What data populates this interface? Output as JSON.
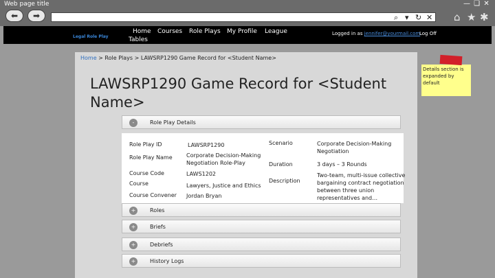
{
  "browser": {
    "window_title": "Web page title",
    "window_controls": "— ❑ ✕",
    "back_icon": "⬅",
    "forward_icon": "➡",
    "search_icon": "⌕",
    "dropdown_icon": "▾",
    "refresh_icon": "↻",
    "close_icon": "✕",
    "home_icon": "⌂",
    "star_icon": "★",
    "settings_icon": "✱",
    "address": ""
  },
  "site": {
    "logo": "Legal Role Play",
    "nav": {
      "home": "Home",
      "courses": "Courses",
      "role_plays": "Role Plays",
      "my_profile": "My Profile",
      "league": "League",
      "tables": "Tables"
    },
    "logged_in_prefix": "Logged in as ",
    "logged_in_user": "jennifer@yourmail.com",
    "log_off": "Log Off"
  },
  "breadcrumb": {
    "home": "Home",
    "rest": " > Role Plays > LAWSRP1290 Game Record for <Student Name>"
  },
  "page_title": "LAWSRP1290 Game Record for <Student Name>",
  "sections": {
    "details": {
      "toggle": "-",
      "title": "Role Play Details"
    },
    "roles": {
      "toggle": "+",
      "title": "Roles"
    },
    "briefs": {
      "toggle": "+",
      "title": "Briefs"
    },
    "debriefs": {
      "toggle": "+",
      "title": "Debriefs"
    },
    "history": {
      "toggle": "+",
      "title": "History Logs"
    }
  },
  "details": {
    "role_play_id": {
      "label": "Role Play ID",
      "value": "LAWSRP1290"
    },
    "role_play_name": {
      "label": "Role Play Name",
      "value": "Corporate Decision-Making Negotiation Role-Play"
    },
    "course_code": {
      "label": "Course Code",
      "value": "LAWS1202"
    },
    "course": {
      "label": "Course",
      "value": "Lawyers, Justice and Ethics"
    },
    "course_convener": {
      "label": "Course Convener",
      "value": "Jordan Bryan"
    },
    "scenario": {
      "label": "Scenario",
      "value": "Corporate Decision-Making Negotiation"
    },
    "duration": {
      "label": "Duration",
      "value": "3 days – 3 Rounds"
    },
    "description": {
      "label": "Description",
      "value": "Two-team, multi-issue collective bargaining contract negotiation between three union representatives and…"
    }
  },
  "annotation": {
    "note": "Details section is expanded by default"
  }
}
